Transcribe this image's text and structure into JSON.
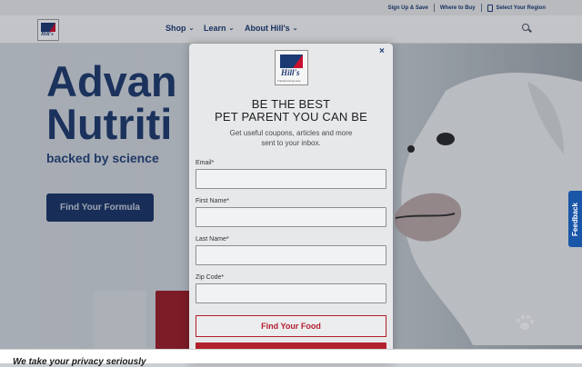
{
  "topbar": {
    "signup": "Sign Up & Save",
    "where_to_buy": "Where to Buy",
    "region": "Select Your Region"
  },
  "brand": {
    "logo_text": "Hill's",
    "tagline": "Transforming Lives"
  },
  "nav": [
    {
      "label": "Shop"
    },
    {
      "label": "Learn"
    },
    {
      "label": "About Hill's"
    }
  ],
  "hero": {
    "title_line1": "Advan",
    "title_line2": "Nutriti",
    "subtitle": "backed by science",
    "cta": "Find Your Formula"
  },
  "modal": {
    "close": "×",
    "title_line1": "BE THE BEST",
    "title_line2": "PET PARENT YOU CAN BE",
    "desc_line1": "Get useful coupons, articles and more",
    "desc_line2": "sent to your inbox.",
    "fields": [
      {
        "label": "Email*",
        "value": ""
      },
      {
        "label": "First Name*",
        "value": ""
      },
      {
        "label": "Last Name*",
        "value": ""
      },
      {
        "label": "Zip Code*",
        "value": ""
      }
    ],
    "find_food": "Find Your Food"
  },
  "feedback": "Feedback",
  "privacy": "We take your privacy seriously",
  "colors": {
    "navy": "#1b3a73",
    "red": "#b21f2d",
    "feedback_blue": "#1a56a8"
  }
}
